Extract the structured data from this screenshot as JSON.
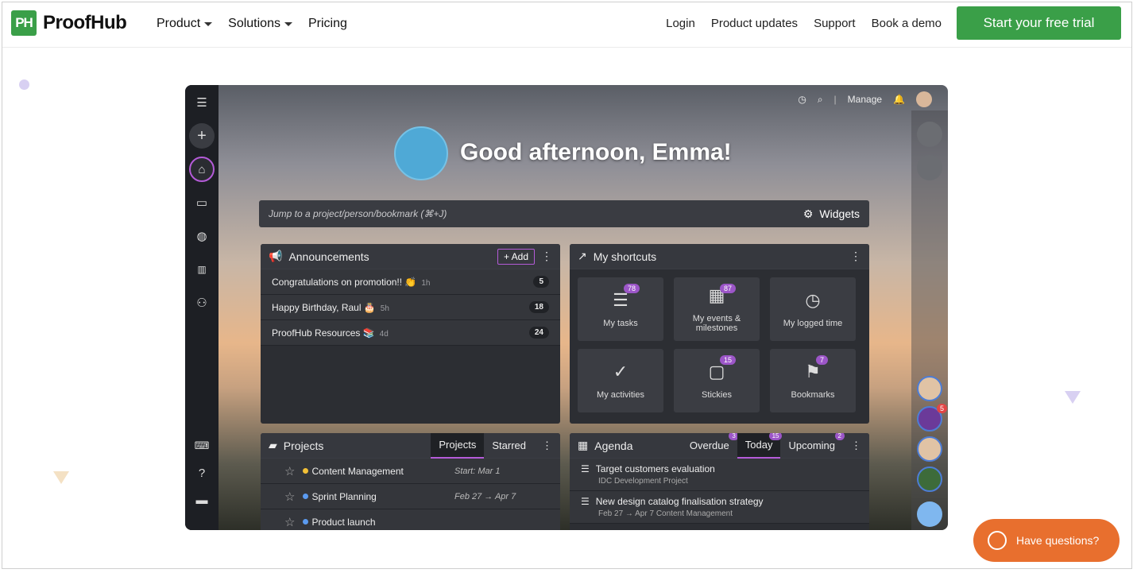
{
  "nav": {
    "logo_mark": "PH",
    "logo_text": "ProofHub",
    "product": "Product",
    "solutions": "Solutions",
    "pricing": "Pricing",
    "login": "Login",
    "updates": "Product updates",
    "support": "Support",
    "demo": "Book a demo",
    "trial": "Start your free trial"
  },
  "app": {
    "greeting": "Good afternoon, Emma!",
    "manage": "Manage",
    "jump_placeholder": "Jump to a project/person/bookmark (⌘+J)",
    "widgets": "Widgets",
    "announcements": {
      "title": "Announcements",
      "add": "+ Add",
      "items": [
        {
          "text": "Congratulations on promotion!! 👏",
          "age": "1h",
          "count": "5"
        },
        {
          "text": "Happy Birthday, Raul 🎂",
          "age": "5h",
          "count": "18"
        },
        {
          "text": "ProofHub Resources 📚",
          "age": "4d",
          "count": "24"
        }
      ]
    },
    "shortcuts": {
      "title": "My shortcuts",
      "items": [
        {
          "label": "My tasks",
          "badge": "78"
        },
        {
          "label": "My events & milestones",
          "badge": "87"
        },
        {
          "label": "My logged time",
          "badge": ""
        },
        {
          "label": "My activities",
          "badge": ""
        },
        {
          "label": "Stickies",
          "badge": "15"
        },
        {
          "label": "Bookmarks",
          "badge": "7"
        }
      ]
    },
    "projects": {
      "title": "Projects",
      "tab1": "Projects",
      "tab2": "Starred",
      "rows": [
        {
          "name": "Content Management",
          "date": "Start: Mar 1",
          "color": "#f2c037"
        },
        {
          "name": "Sprint Planning",
          "date": "Feb 27 → Apr 7",
          "color": "#5b9bf0"
        },
        {
          "name": "Product launch",
          "date": "",
          "color": "#5b9bf0"
        }
      ]
    },
    "agenda": {
      "title": "Agenda",
      "overdue": "Overdue",
      "overdue_n": "3",
      "today": "Today",
      "today_n": "15",
      "upcoming": "Upcoming",
      "upcoming_n": "2",
      "rows": [
        {
          "title": "Target customers evaluation",
          "sub": "IDC Development Project"
        },
        {
          "title": "New design catalog finalisation strategy",
          "sub": "Feb 27 → Apr 7   Content Management"
        }
      ]
    },
    "right_badge": "5"
  },
  "chat": "Have questions?"
}
